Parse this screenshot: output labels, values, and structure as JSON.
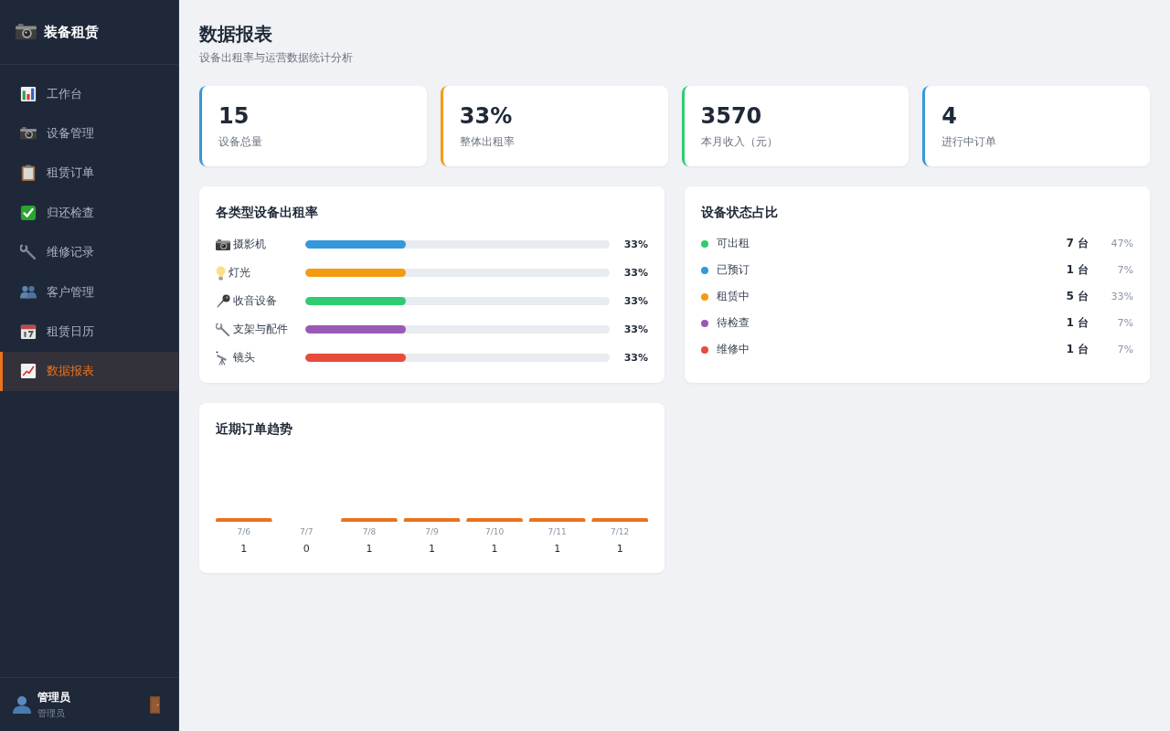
{
  "sidebar": {
    "brand": "装备租赁",
    "items": [
      {
        "label": "工作台",
        "selected": false
      },
      {
        "label": "设备管理",
        "selected": false
      },
      {
        "label": "租赁订单",
        "selected": false
      },
      {
        "label": "归还检查",
        "selected": false
      },
      {
        "label": "维修记录",
        "selected": false
      },
      {
        "label": "客户管理",
        "selected": false
      },
      {
        "label": "租赁日历",
        "selected": false
      },
      {
        "label": "数据报表",
        "selected": true
      }
    ],
    "user": {
      "name": "管理员",
      "role": "管理员"
    }
  },
  "page": {
    "title": "数据报表",
    "subtitle": "设备出租率与运营数据统计分析"
  },
  "stats": [
    {
      "value": "15",
      "label": "设备总量",
      "color": "#3498db"
    },
    {
      "value": "33%",
      "label": "整体出租率",
      "color": "#f39c12"
    },
    {
      "value": "3570",
      "label": "本月收入（元）",
      "color": "#2ecc71"
    },
    {
      "value": "4",
      "label": "进行中订单",
      "color": "#3498db"
    }
  ],
  "category_rates": {
    "title": "各类型设备出租率",
    "rows": [
      {
        "name": "摄影机",
        "level": 0.33,
        "reading": "33%",
        "color": "#3498db"
      },
      {
        "name": "灯光",
        "level": 0.33,
        "reading": "33%",
        "color": "#f39c12"
      },
      {
        "name": "收音设备",
        "level": 0.33,
        "reading": "33%",
        "color": "#2ecc71"
      },
      {
        "name": "支架与配件",
        "level": 0.33,
        "reading": "33%",
        "color": "#9b59b6"
      },
      {
        "name": "镜头",
        "level": 0.33,
        "reading": "33%",
        "color": "#e74c3c"
      }
    ]
  },
  "status_share": {
    "title": "设备状态占比",
    "rows": [
      {
        "label": "可出租",
        "count": "7 台",
        "share": "47%",
        "color": "#2ecc71"
      },
      {
        "label": "已预订",
        "count": "1 台",
        "share": "7%",
        "color": "#3498db"
      },
      {
        "label": "租赁中",
        "count": "5 台",
        "share": "33%",
        "color": "#f39c12"
      },
      {
        "label": "待检查",
        "count": "1 台",
        "share": "7%",
        "color": "#9b59b6"
      },
      {
        "label": "维修中",
        "count": "1 台",
        "share": "7%",
        "color": "#e74c3c"
      }
    ]
  },
  "order_trend": {
    "title": "近期订单趋势",
    "chart_data": {
      "type": "bar",
      "categories": [
        "7/6",
        "7/7",
        "7/8",
        "7/9",
        "7/10",
        "7/11",
        "7/12"
      ],
      "values": [
        1,
        0,
        1,
        1,
        1,
        1,
        1
      ],
      "data_labels": true
    }
  }
}
